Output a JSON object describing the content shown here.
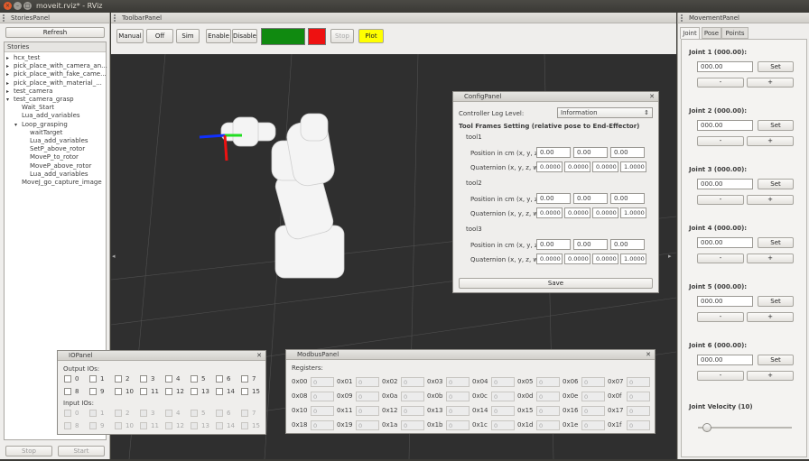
{
  "window": {
    "title": "moveit.rviz* - RViz"
  },
  "stories": {
    "title": "StoriesPanel",
    "refresh": "Refresh",
    "header": "Stories",
    "items": [
      {
        "label": "hcx_test",
        "arrow": "▸"
      },
      {
        "label": "pick_place_with_camera_an...",
        "arrow": "▸"
      },
      {
        "label": "pick_place_with_fake_came...",
        "arrow": "▸"
      },
      {
        "label": "pick_place_with_material_...",
        "arrow": "▸"
      },
      {
        "label": "test_camera",
        "arrow": "▸"
      },
      {
        "label": "test_camera_grasp",
        "arrow": "▾"
      },
      {
        "label": "Wait_Start",
        "arrow": ""
      },
      {
        "label": "Lua_add_variables",
        "arrow": ""
      },
      {
        "label": "Loop_grasping",
        "arrow": "▾"
      },
      {
        "label": "waitTarget",
        "arrow": ""
      },
      {
        "label": "Lua_add_variables",
        "arrow": ""
      },
      {
        "label": "SetP_above_rotor",
        "arrow": ""
      },
      {
        "label": "MoveP_to_rotor",
        "arrow": ""
      },
      {
        "label": "MoveP_above_rotor",
        "arrow": ""
      },
      {
        "label": "Lua_add_variables",
        "arrow": ""
      },
      {
        "label": "MoveJ_go_capture_image",
        "arrow": ""
      }
    ],
    "stop": "Stop",
    "start": "Start"
  },
  "toolbar": {
    "title": "ToolbarPanel",
    "manual": "Manual",
    "off": "Off",
    "sim": "Sim",
    "enable": "Enable",
    "disable": "Disable",
    "stop": "Stop",
    "plot": "Plot",
    "green": "#108a10",
    "red": "#ee1111",
    "yellow": "#ffff00"
  },
  "config": {
    "title": "ConfigPanel",
    "log_label": "Controller Log Level:",
    "log_value": "Information",
    "tool_heading": "Tool Frames Setting (relative pose to End-Effector)",
    "pos_label": "Position in cm (x, y, z):",
    "quat_label": "Quaternion (x, y, z, w):",
    "tools": [
      {
        "name": "tool1",
        "pos": [
          "0.00",
          "0.00",
          "0.00"
        ],
        "quat": [
          "0.0000",
          "0.0000",
          "0.0000",
          "1.0000"
        ]
      },
      {
        "name": "tool2",
        "pos": [
          "0.00",
          "0.00",
          "0.00"
        ],
        "quat": [
          "0.0000",
          "0.0000",
          "0.0000",
          "1.0000"
        ]
      },
      {
        "name": "tool3",
        "pos": [
          "0.00",
          "0.00",
          "0.00"
        ],
        "quat": [
          "0.0000",
          "0.0000",
          "0.0000",
          "1.0000"
        ]
      }
    ],
    "save": "Save"
  },
  "io": {
    "title": "IOPanel",
    "output_label": "Output IOs:",
    "input_label": "Input IOs:",
    "row1": [
      "0",
      "1",
      "2",
      "3",
      "4",
      "5",
      "6",
      "7"
    ],
    "row2": [
      "8",
      "9",
      "10",
      "11",
      "12",
      "13",
      "14",
      "15"
    ]
  },
  "modbus": {
    "title": "ModbusPanel",
    "registers_label": "Registers:",
    "value": "0",
    "rows": [
      [
        "0x00",
        "0x01",
        "0x02",
        "0x03",
        "0x04",
        "0x05",
        "0x06",
        "0x07"
      ],
      [
        "0x08",
        "0x09",
        "0x0a",
        "0x0b",
        "0x0c",
        "0x0d",
        "0x0e",
        "0x0f"
      ],
      [
        "0x10",
        "0x11",
        "0x12",
        "0x13",
        "0x14",
        "0x15",
        "0x16",
        "0x17"
      ],
      [
        "0x18",
        "0x19",
        "0x1a",
        "0x1b",
        "0x1c",
        "0x1d",
        "0x1e",
        "0x1f"
      ]
    ]
  },
  "movement": {
    "title": "MovementPanel",
    "tabs": [
      "Joint",
      "Pose",
      "Points"
    ],
    "set": "Set",
    "minus": "-",
    "plus": "+",
    "joints": [
      {
        "label": "Joint 1 (000.00):",
        "value": "000.00"
      },
      {
        "label": "Joint 2 (000.00):",
        "value": "000.00"
      },
      {
        "label": "Joint 3 (000.00):",
        "value": "000.00"
      },
      {
        "label": "Joint 4 (000.00):",
        "value": "000.00"
      },
      {
        "label": "Joint 5 (000.00):",
        "value": "000.00"
      },
      {
        "label": "Joint 6 (000.00):",
        "value": "000.00"
      }
    ],
    "velocity_label": "Joint Velocity (10)",
    "velocity": 0.1
  }
}
